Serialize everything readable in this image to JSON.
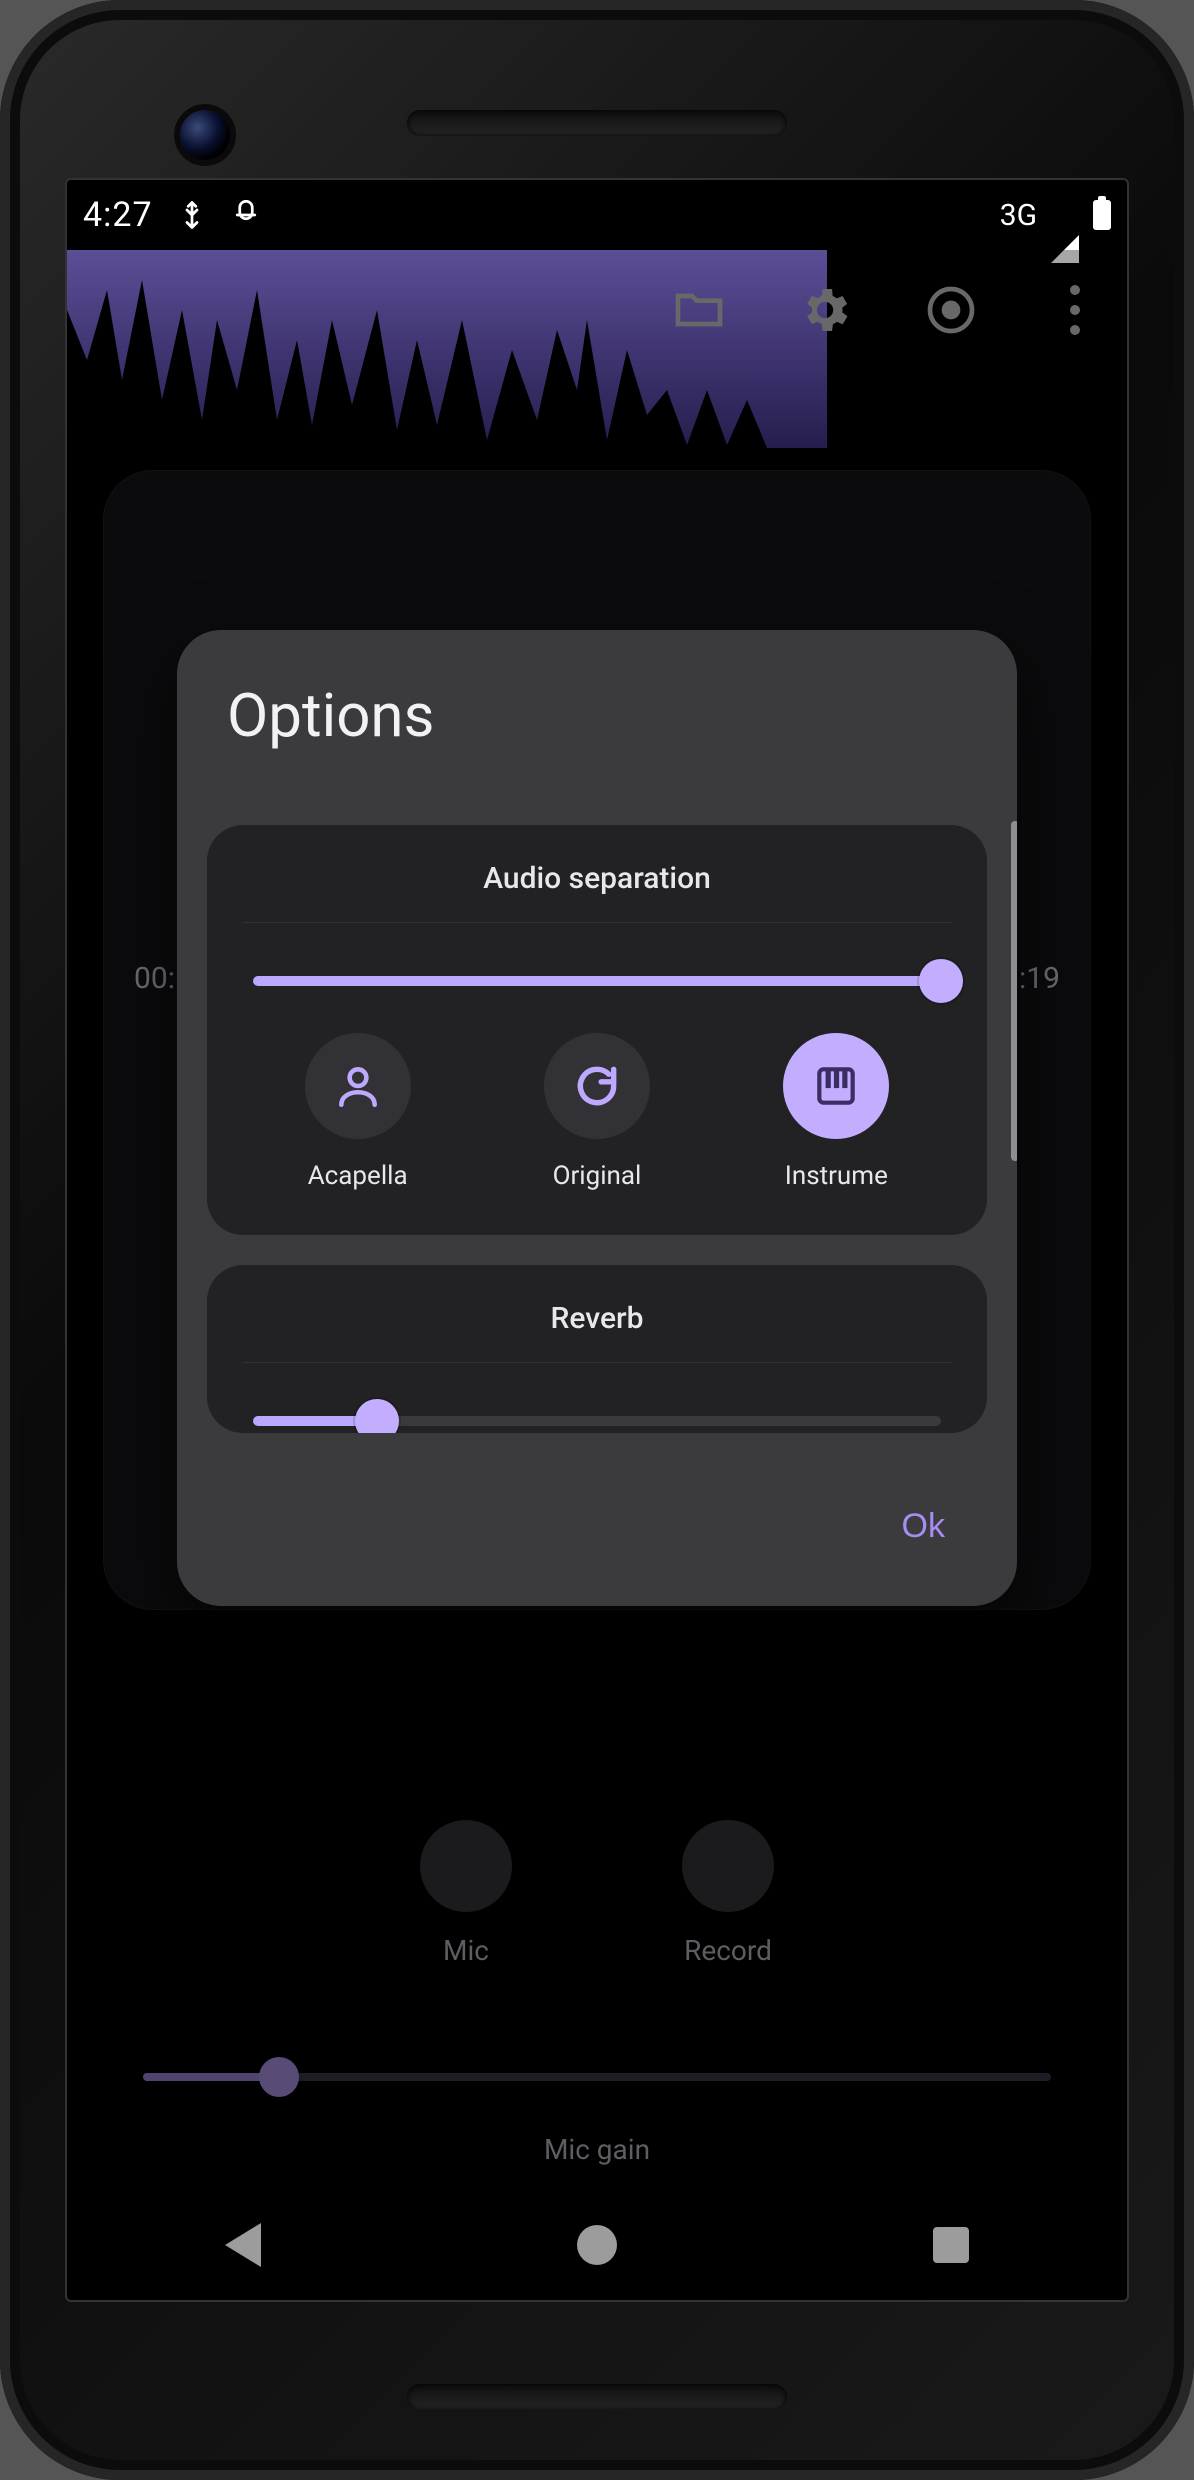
{
  "status": {
    "time": "4:27",
    "network_label": "3G"
  },
  "background": {
    "time_left": "00:",
    "time_right": ":19",
    "controls": {
      "mic_label": "Mic",
      "record_label": "Record",
      "gain_label": "Mic gain",
      "gain_percent": 15
    }
  },
  "modal": {
    "title": "Options",
    "ok_label": "Ok",
    "sections": {
      "audio_separation": {
        "title": "Audio separation",
        "slider_percent": 100,
        "modes": [
          {
            "label": "Acapella",
            "icon": "person-icon",
            "active": false
          },
          {
            "label": "Original",
            "icon": "refresh-icon",
            "active": false
          },
          {
            "label": "Instrume",
            "icon": "piano-icon",
            "active": true
          }
        ]
      },
      "reverb": {
        "title": "Reverb",
        "slider_percent": 18
      }
    }
  },
  "colors": {
    "accent": "#bca9ff",
    "accent_strong": "#c2adff",
    "modal_bg": "#3b3b3e",
    "card_bg": "#222225"
  }
}
